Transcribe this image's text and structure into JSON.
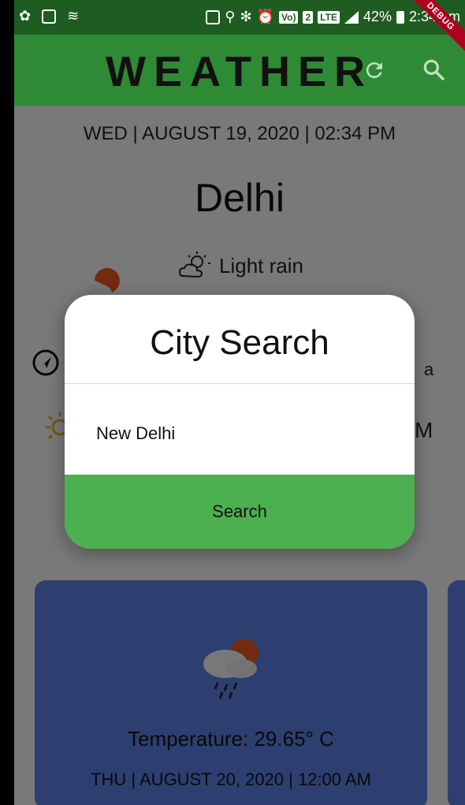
{
  "status_bar": {
    "battery": "42%",
    "time": "2:34 pm",
    "network": "LTE",
    "sim": "2"
  },
  "debug_banner": "DEBUG",
  "app_bar": {
    "title": "WEATHER",
    "icons": [
      "refresh-icon",
      "search-icon"
    ]
  },
  "main": {
    "date_time": "WED | AUGUST 19, 2020 |  02:34 PM",
    "city": "Delhi",
    "condition": "Light rain",
    "partial_right_a": "a",
    "partial_right_pm": "M"
  },
  "dialog": {
    "title": "City Search",
    "input_value": "New Delhi",
    "search_label": "Search"
  },
  "forecast": [
    {
      "temperature": "Temperature: 29.65° C",
      "date_time": "THU | AUGUST 20, 2020 |  12:00 AM"
    }
  ],
  "colors": {
    "app_bar": "#2f8a36",
    "status_bar": "#1f5c22",
    "card": "#5a7fe0",
    "search_button": "#4caf50"
  }
}
